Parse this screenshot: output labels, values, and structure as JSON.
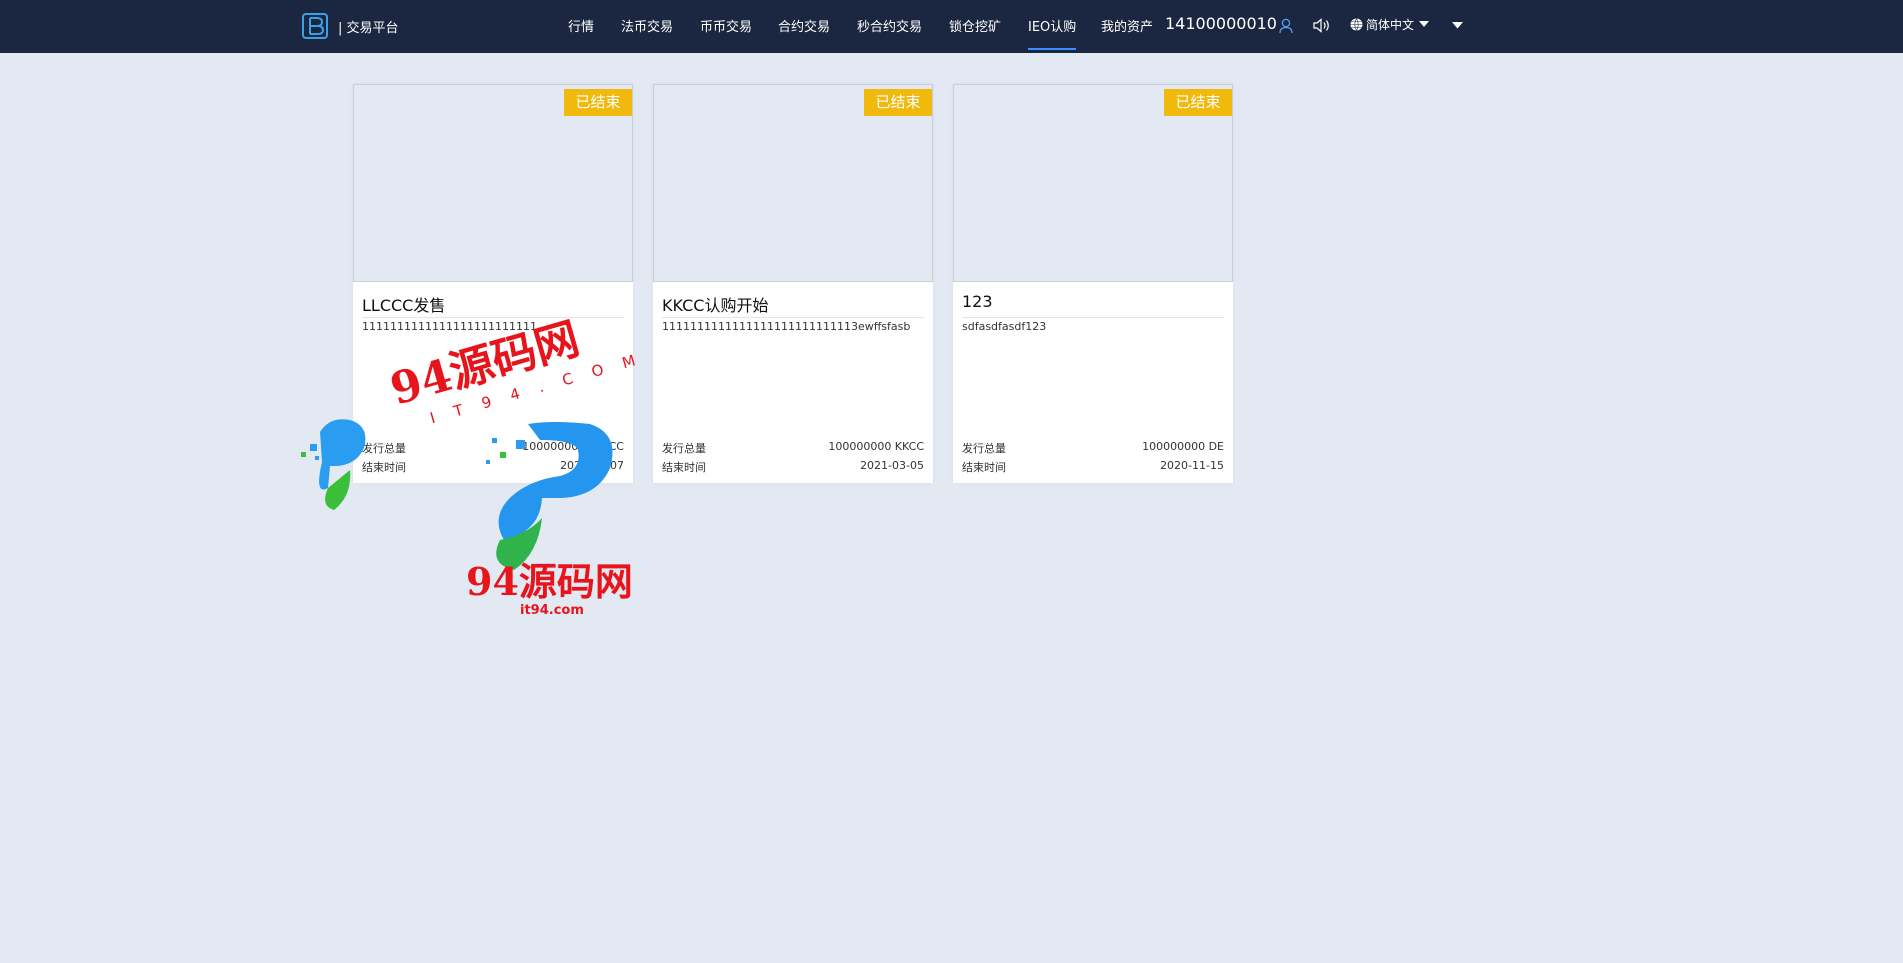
{
  "header": {
    "brand": "| 交易平台",
    "nav": [
      {
        "label": "行情"
      },
      {
        "label": "法币交易"
      },
      {
        "label": "币币交易"
      },
      {
        "label": "合约交易"
      },
      {
        "label": "秒合约交易"
      },
      {
        "label": "锁仓挖矿"
      },
      {
        "label": "IEO认购",
        "active": true
      },
      {
        "label": "我的资产"
      }
    ],
    "account": "14100000010",
    "language": "简体中文",
    "icons": [
      "logo-icon",
      "user-icon",
      "volume-icon",
      "globe-icon",
      "caret-down-icon"
    ]
  },
  "cards": [
    {
      "status": "已结束",
      "title": "LLCCC发售",
      "desc": "1111111111111111111111111",
      "total_label": "发行总量",
      "total_value": "100000000 LLCCC",
      "end_label": "结束时间",
      "end_value": "2021-03-07"
    },
    {
      "status": "已结束",
      "title": "KKCC认购开始",
      "desc": "1111111111111111111111111113ewffsfasb",
      "total_label": "发行总量",
      "total_value": "100000000 KKCC",
      "end_label": "结束时间",
      "end_value": "2021-03-05"
    },
    {
      "status": "已结束",
      "title": "123",
      "desc": "sdfasdfasdf123",
      "total_label": "发行总量",
      "total_value": "100000000 DE",
      "end_label": "结束时间",
      "end_value": "2020-11-15"
    }
  ],
  "watermark": {
    "top_text": "94源码网",
    "top_sub": "IT94.COM",
    "bottom_text": "94源码网",
    "bottom_sub": "it94.com"
  },
  "colors": {
    "header_bg": "#1b2640",
    "page_bg": "#e3e9f3",
    "badge": "#f0b90b",
    "nav_active": "#3a8dff",
    "watermark_red": "#e8141c"
  }
}
